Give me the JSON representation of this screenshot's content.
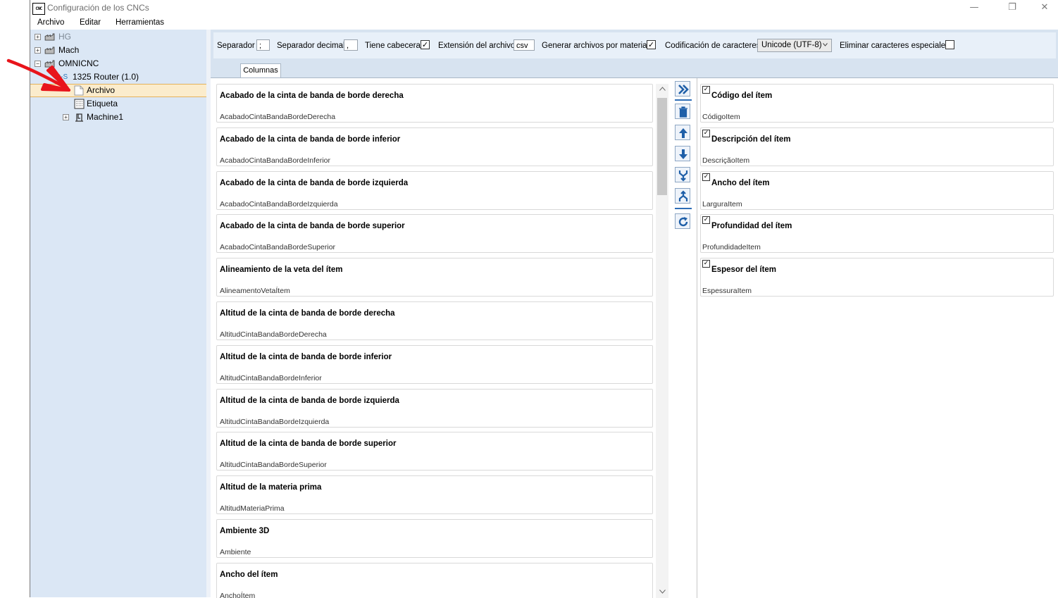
{
  "window": {
    "icon_text": "CNC",
    "title": "Configuración de los CNCs",
    "minimize": "—",
    "restore": "❐",
    "close": "✕"
  },
  "menu": [
    "Archivo",
    "Editar",
    "Herramientas"
  ],
  "tree": {
    "hg": "HG",
    "mach": "Mach",
    "omnicnc": "OMNICNC",
    "router": "1325 Router (1.0)",
    "router_prefix": "D-S",
    "archivo": "Archivo",
    "etiqueta": "Etiqueta",
    "machine1": "Machine1"
  },
  "options": {
    "separador_label": "Separador",
    "separador_value": ";",
    "decimal_label": "Separador decimal",
    "decimal_value": ",",
    "cabecera_label": "Tiene cabecera",
    "cabecera_checked": "✓",
    "extension_label": "Extensión del archivo",
    "extension_value": "csv",
    "por_material_label": "Generar archivos por material",
    "por_material_checked": "✓",
    "codificacion_label": "Codificación de caracteres",
    "codificacion_value": "Unicode (UTF-8)",
    "eliminar_label": "Eliminar caracteres especiales"
  },
  "tab_label": "Columnas",
  "available_columns": [
    {
      "title": "Acabado de la cinta de banda de borde derecha",
      "key": "AcabadoCintaBandaBordeDerecha"
    },
    {
      "title": "Acabado de la cinta de banda de borde inferior",
      "key": "AcabadoCintaBandaBordeInferior"
    },
    {
      "title": "Acabado de la cinta de banda de borde izquierda",
      "key": "AcabadoCintaBandaBordeIzquierda"
    },
    {
      "title": "Acabado de la cinta de banda de borde superior",
      "key": "AcabadoCintaBandaBordeSuperior"
    },
    {
      "title": "Alineamiento de la veta del ítem",
      "key": "AlineamentoVetaÍtem"
    },
    {
      "title": "Altitud de la cinta de banda de borde derecha",
      "key": "AltitudCintaBandaBordeDerecha"
    },
    {
      "title": "Altitud de la cinta de banda de borde inferior",
      "key": "AltitudCintaBandaBordeInferior"
    },
    {
      "title": "Altitud de la cinta de banda de borde izquierda",
      "key": "AltitudCintaBandaBordeIzquierda"
    },
    {
      "title": "Altitud de la cinta de banda de borde superior",
      "key": "AltitudCintaBandaBordeSuperior"
    },
    {
      "title": "Altitud de la materia prima",
      "key": "AltitudMateriaPrima"
    },
    {
      "title": "Ambiente 3D",
      "key": "Ambiente"
    },
    {
      "title": "Ancho del ítem",
      "key": "AnchoÍtem"
    }
  ],
  "selected_columns": [
    {
      "title": "Código del ítem",
      "key": "CódigoItem",
      "check": "✓"
    },
    {
      "title": "Descripción del ítem",
      "key": "DescriçãoItem",
      "check": "✓"
    },
    {
      "title": "Ancho del ítem",
      "key": "LarguraItem",
      "check": "✓"
    },
    {
      "title": "Profundidad del ítem",
      "key": "ProfundidadeItem",
      "check": "✓"
    },
    {
      "title": "Espesor del ítem",
      "key": "EspessuraItem",
      "check": "✓"
    }
  ],
  "colors": {
    "tree_bg": "#dbe7f5",
    "selection": "#fbeccc",
    "accent_blue": "#2e6db6",
    "annotation_red": "#e8141b"
  }
}
